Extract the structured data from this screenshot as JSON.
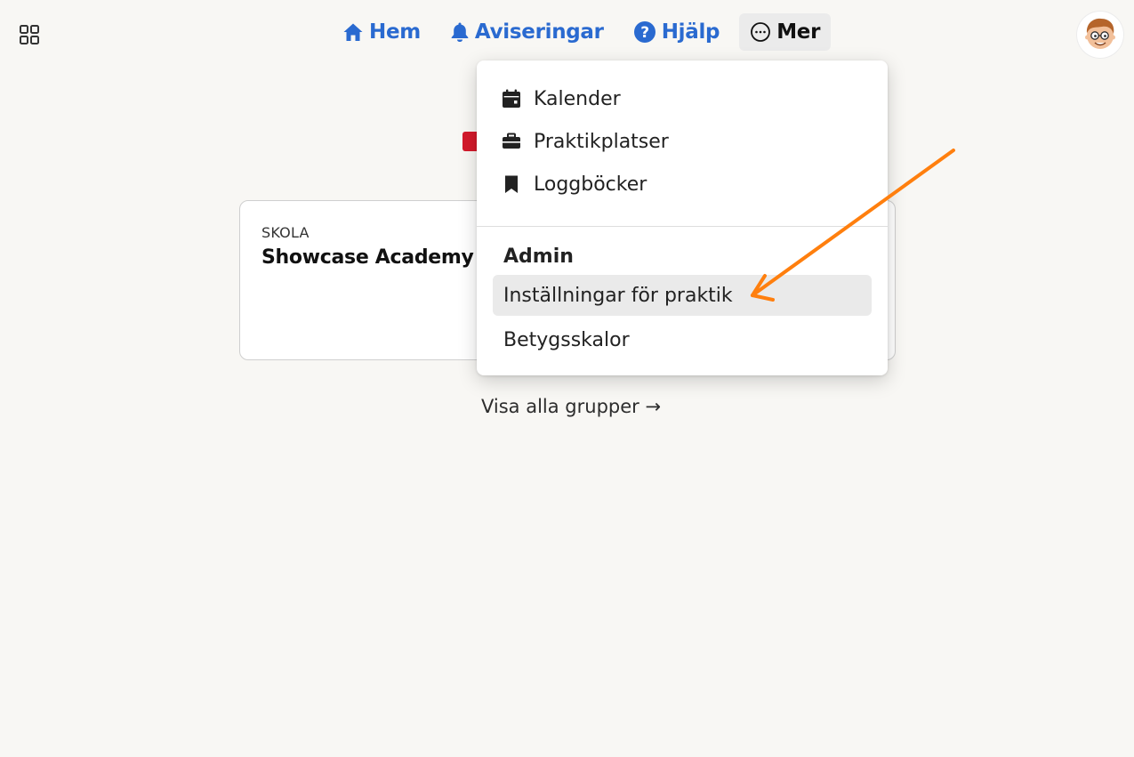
{
  "apps_button": {
    "icon": "grid-icon"
  },
  "nav": {
    "home": {
      "label": "Hem",
      "icon": "home-icon"
    },
    "notifications": {
      "label": "Aviseringar",
      "icon": "bell-icon"
    },
    "help": {
      "label": "Hjälp",
      "icon": "question-circle-icon"
    },
    "more": {
      "label": "Mer",
      "icon": "more-circle-icon"
    }
  },
  "avatar": {
    "icon": "user-avatar-cartoon"
  },
  "card": {
    "label": "SKOLA",
    "title": "Showcase Academy"
  },
  "show_all": {
    "label": "Visa alla grupper →"
  },
  "dropdown": {
    "items": [
      {
        "label": "Kalender",
        "icon": "calendar-icon"
      },
      {
        "label": "Praktikplatser",
        "icon": "briefcase-icon"
      },
      {
        "label": "Loggböcker",
        "icon": "bookmark-icon"
      }
    ],
    "admin_header": "Admin",
    "admin_items": [
      {
        "label": "Inställningar för praktik",
        "active": true
      },
      {
        "label": "Betygsskalor",
        "active": false
      }
    ]
  },
  "annotation": {
    "color": "#ff7f0e"
  },
  "colors": {
    "nav_blue": "#2a6ad0",
    "badge_red": "#d4192b",
    "background": "#f8f7f4"
  }
}
